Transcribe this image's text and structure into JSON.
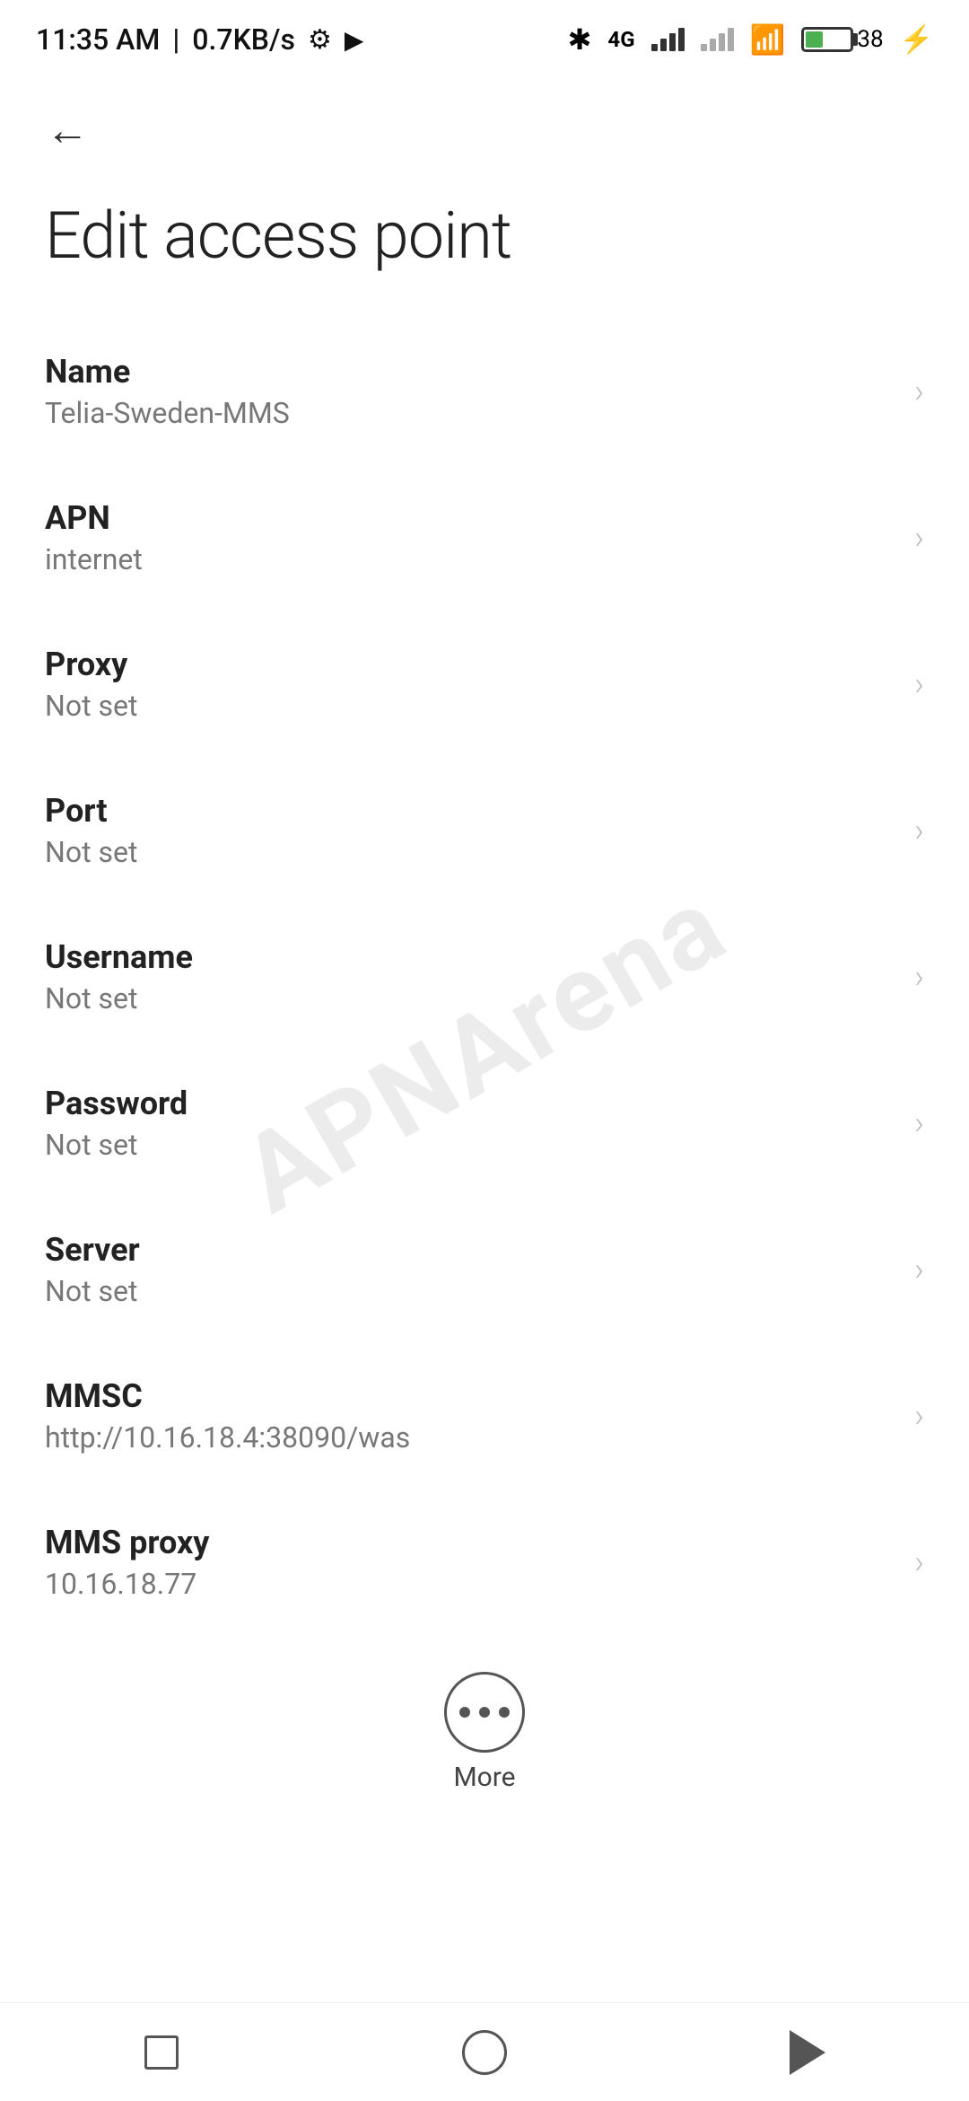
{
  "status_bar": {
    "time": "11:35 AM",
    "speed": "0.7KB/s"
  },
  "page": {
    "title": "Edit access point",
    "back_label": "←"
  },
  "settings": {
    "items": [
      {
        "label": "Name",
        "value": "Telia-Sweden-MMS"
      },
      {
        "label": "APN",
        "value": "internet"
      },
      {
        "label": "Proxy",
        "value": "Not set"
      },
      {
        "label": "Port",
        "value": "Not set"
      },
      {
        "label": "Username",
        "value": "Not set"
      },
      {
        "label": "Password",
        "value": "Not set"
      },
      {
        "label": "Server",
        "value": "Not set"
      },
      {
        "label": "MMSC",
        "value": "http://10.16.18.4:38090/was"
      },
      {
        "label": "MMS proxy",
        "value": "10.16.18.77"
      }
    ]
  },
  "more_button": {
    "label": "More"
  },
  "bottom_nav": {
    "square_label": "square-nav",
    "circle_label": "circle-nav",
    "triangle_label": "triangle-nav"
  },
  "watermark": {
    "text": "APNArena"
  }
}
